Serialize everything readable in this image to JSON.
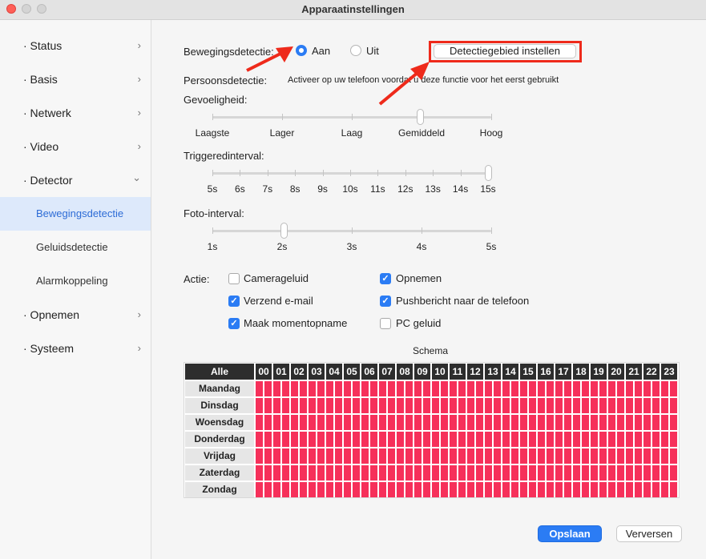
{
  "window": {
    "title": "Apparaatinstellingen"
  },
  "sidebar": {
    "items": [
      {
        "label": "· Status",
        "chevron": "›"
      },
      {
        "label": "· Basis",
        "chevron": "›"
      },
      {
        "label": "· Netwerk",
        "chevron": "›"
      },
      {
        "label": "· Video",
        "chevron": "›"
      },
      {
        "label": "· Detector",
        "chevron": "⌄"
      },
      {
        "label": "Bewegingsdetectie"
      },
      {
        "label": "Geluidsdetectie"
      },
      {
        "label": "Alarmkoppeling"
      },
      {
        "label": "· Opnemen",
        "chevron": "›"
      },
      {
        "label": "· Systeem",
        "chevron": "›"
      }
    ]
  },
  "motion": {
    "label": "Bewegingsdetectie:",
    "on_label": "Aan",
    "off_label": "Uit",
    "selected": "Aan",
    "area_button": "Detectiegebied instellen"
  },
  "person": {
    "label": "Persoonsdetectie:",
    "note": "Activeer op uw telefoon voordat u deze functie voor het eerst gebruikt"
  },
  "sensitivity": {
    "label": "Gevoeligheid:",
    "ticks": [
      "Laagste",
      "Lager",
      "Laag",
      "Gemiddeld",
      "Hoog"
    ],
    "value": "Gemiddeld"
  },
  "trigger": {
    "label": "Triggeredinterval:",
    "ticks": [
      "5s",
      "6s",
      "7s",
      "8s",
      "9s",
      "10s",
      "11s",
      "12s",
      "13s",
      "14s",
      "15s"
    ],
    "value": "15s"
  },
  "photo": {
    "label": "Foto-interval:",
    "ticks": [
      "1s",
      "2s",
      "3s",
      "4s",
      "5s"
    ],
    "value": "2s"
  },
  "actions": {
    "label": "Actie:",
    "items": [
      {
        "label": "Camerageluid",
        "checked": false
      },
      {
        "label": "Opnemen",
        "checked": true
      },
      {
        "label": "Verzend e-mail",
        "checked": true
      },
      {
        "label": "Pushbericht naar de telefoon",
        "checked": true
      },
      {
        "label": "Maak momentopname",
        "checked": true
      },
      {
        "label": "PC geluid",
        "checked": false
      }
    ]
  },
  "schedule": {
    "title": "Schema",
    "all_label": "Alle",
    "hours": [
      "00",
      "01",
      "02",
      "03",
      "04",
      "05",
      "06",
      "07",
      "08",
      "09",
      "10",
      "11",
      "12",
      "13",
      "14",
      "15",
      "16",
      "17",
      "18",
      "19",
      "20",
      "21",
      "22",
      "23"
    ],
    "days": [
      "Maandag",
      "Dinsdag",
      "Woensdag",
      "Donderdag",
      "Vrijdag",
      "Zaterdag",
      "Zondag"
    ],
    "active_color": "#f6305a"
  },
  "buttons": {
    "save": "Opslaan",
    "refresh": "Verversen"
  },
  "colors": {
    "accent": "#2b7cf4",
    "highlight": "#ee2a1b",
    "schedule_on": "#f6305a"
  }
}
